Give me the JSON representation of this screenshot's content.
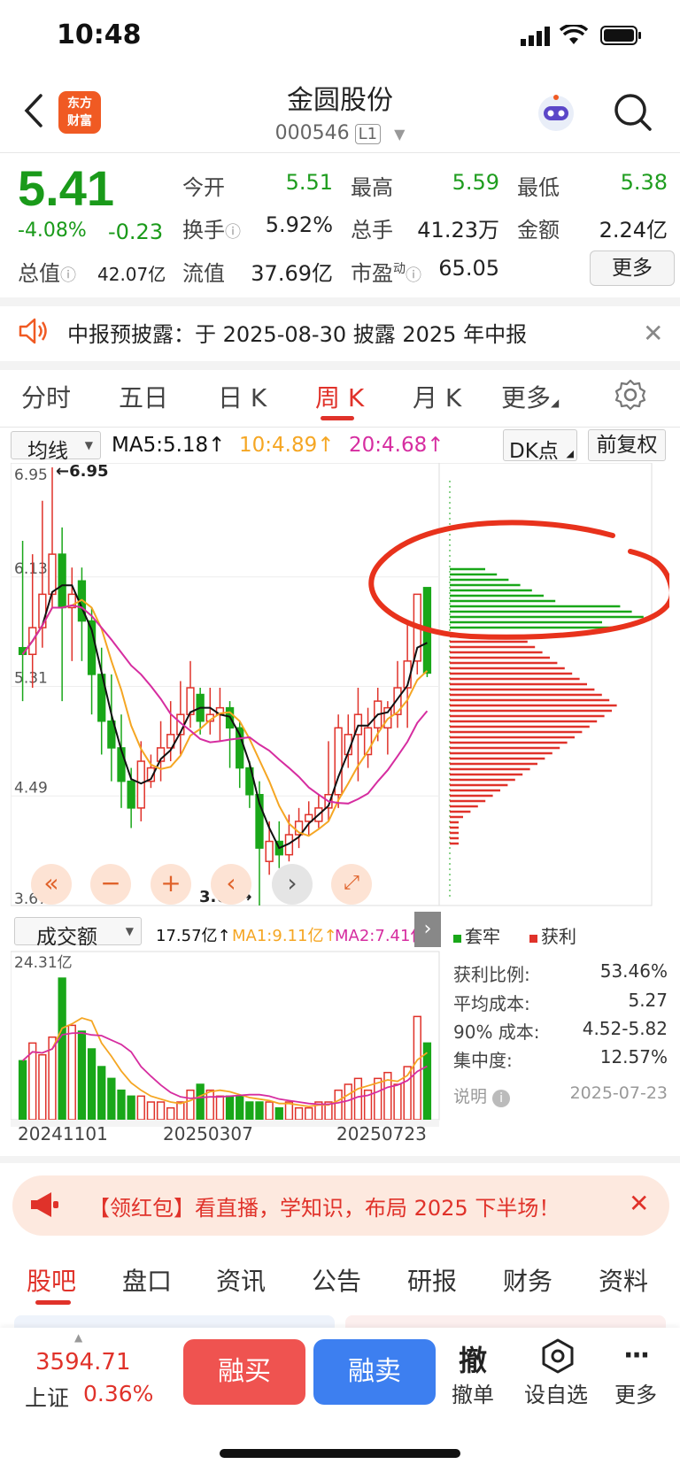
{
  "status_bar": {
    "time": "10:48"
  },
  "header": {
    "logo_text_1": "东方",
    "logo_text_2": "财富",
    "title": "金圆股份",
    "code": "000546",
    "level": "L1"
  },
  "quote": {
    "price": "5.41",
    "change_pct": "-4.08%",
    "change": "-0.23",
    "open_label": "今开",
    "open": "5.51",
    "high_label": "最高",
    "high": "5.59",
    "low_label": "最低",
    "low": "5.38",
    "turnover_label": "换手",
    "turnover": "5.92%",
    "volume_label": "总手",
    "volume": "41.23万",
    "amount_label": "金额",
    "amount": "2.24亿",
    "mktcap_label": "总值",
    "mktcap": "42.07亿",
    "float_label": "流值",
    "float_cap": "37.69亿",
    "pe_label": "市盈",
    "pe_sup": "动",
    "pe": "65.05",
    "more": "更多"
  },
  "notice": {
    "text": "中报预披露：于 2025-08-30 披露 2025 年中报"
  },
  "kline_tabs": [
    "分时",
    "五日",
    "日 K",
    "周 K",
    "月 K",
    "更多"
  ],
  "kline_active": "周 K",
  "ma_bar": {
    "indicator": "均线",
    "ma5": "MA5:5.18↑",
    "ma10": "10:4.89↑",
    "ma20": "20:4.68↑",
    "dk": "DK点",
    "adjust": "前复权"
  },
  "chart": {
    "y_ticks": [
      "6.95",
      "6.13",
      "5.31",
      "4.49",
      "3.67"
    ],
    "max_label": "←6.95",
    "min_label": "3.67→",
    "colors": {
      "up": "#e0322a",
      "down": "#19a719",
      "ma5": "#111111",
      "ma10": "#f5a623",
      "ma20": "#d62da0",
      "circle": "#e8321c"
    }
  },
  "volume_bar": {
    "indicator": "成交额",
    "value": "17.57亿↑",
    "ma1": "MA1:9.11亿↑",
    "ma2": "MA2:7.41亿↑",
    "max_label": "24.31亿",
    "dates": [
      "20241101",
      "20250307",
      "20250723"
    ]
  },
  "chip": {
    "legend_trapped": "套牢",
    "legend_profit": "获利",
    "stats": [
      {
        "label": "获利比例:",
        "value": "53.46%"
      },
      {
        "label": "平均成本:",
        "value": "5.27"
      },
      {
        "label": "90% 成本:",
        "value": "4.52-5.82"
      },
      {
        "label": "集中度:",
        "value": "12.57%"
      }
    ],
    "note_label": "说明",
    "date": "2025-07-23"
  },
  "promo": {
    "text": "【领红包】看直播，学知识，布局 2025 下半场！"
  },
  "bottom_tabs": [
    "股吧",
    "盘口",
    "资讯",
    "公告",
    "研报",
    "财务",
    "资料"
  ],
  "bottom_active": "股吧",
  "footer": {
    "index_value": "3594.71",
    "index_name": "上证",
    "index_pct": "0.36%",
    "buy": "融买",
    "sell": "融卖",
    "cancel_icon": "撤",
    "cancel": "撤单",
    "favorite": "设自选",
    "more": "更多"
  }
}
